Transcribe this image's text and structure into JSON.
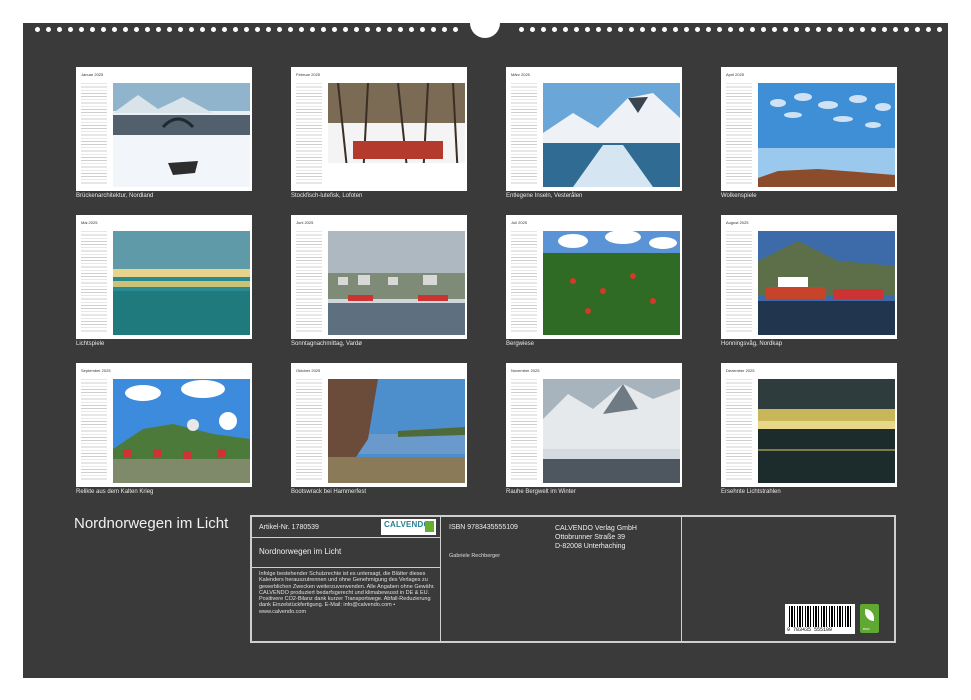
{
  "calendar_title": "Nordnorwegen im Licht",
  "months": [
    {
      "label": "Januar 2025",
      "caption": "Brückenarchitektur, Nordland",
      "scene": "snow-bridge"
    },
    {
      "label": "Februar 2025",
      "caption": "Stockfisch-lutefisk, Lofoten",
      "scene": "fish-racks"
    },
    {
      "label": "März 2025",
      "caption": "Entlegene Inseln, Vesterålen",
      "scene": "wake-mountains"
    },
    {
      "label": "April 2025",
      "caption": "Wolkenspiele",
      "scene": "clouds"
    },
    {
      "label": "Mai 2025",
      "caption": "Lichtspiele",
      "scene": "lightplay"
    },
    {
      "label": "Juni 2025",
      "caption": "Sonntagnachmittag, Vardø",
      "scene": "harbour"
    },
    {
      "label": "Juli 2025",
      "caption": "Bergwiese",
      "scene": "meadow"
    },
    {
      "label": "August 2025",
      "caption": "Honningsvåg, Nordkap",
      "scene": "boats"
    },
    {
      "label": "September 2025",
      "caption": "Relikte aus dem Kalten Krieg",
      "scene": "radar"
    },
    {
      "label": "Oktober 2025",
      "caption": "Bootswrack bei Hammerfest",
      "scene": "wreck"
    },
    {
      "label": "November 2025",
      "caption": "Rauhe Bergwelt im Winter",
      "scene": "winter-mountain"
    },
    {
      "label": "Dezember 2025",
      "caption": "Ersehnte Lichtstrahlen",
      "scene": "sun-rays"
    }
  ],
  "info": {
    "article_no": "Artikel-Nr. 1780539",
    "title": "Nordnorwegen im Licht",
    "legal_text": "Infolge bestehender Schutzrechte ist es untersagt, die Blätter dieses Kalenders herauszutrennen und ohne Genehmigung des Verlages zu gewerblichen Zwecken weiterzuverwenden. Alle Angaben ohne Gewähr. CALVENDO produziert bedarfsgerecht und klimabewusst in DE & EU. Positivere CO2-Bilanz dank kurzer Transportwege. Abfall-Reduzierung dank Einzelstückfertigung. E-Mail: info@calvendo.com • www.calvendo.com",
    "isbn": "ISBN 9783435555109",
    "publisher_name": "CALVENDO Verlag GmbH",
    "publisher_street": "Ottobrunner Straße 39",
    "publisher_city": "D-82008 Unterhaching",
    "author": "Gabriele Rechberger",
    "logo_text": "CALVENDO",
    "barcode_number": "9 783435 555109",
    "eco_label": "eco"
  }
}
